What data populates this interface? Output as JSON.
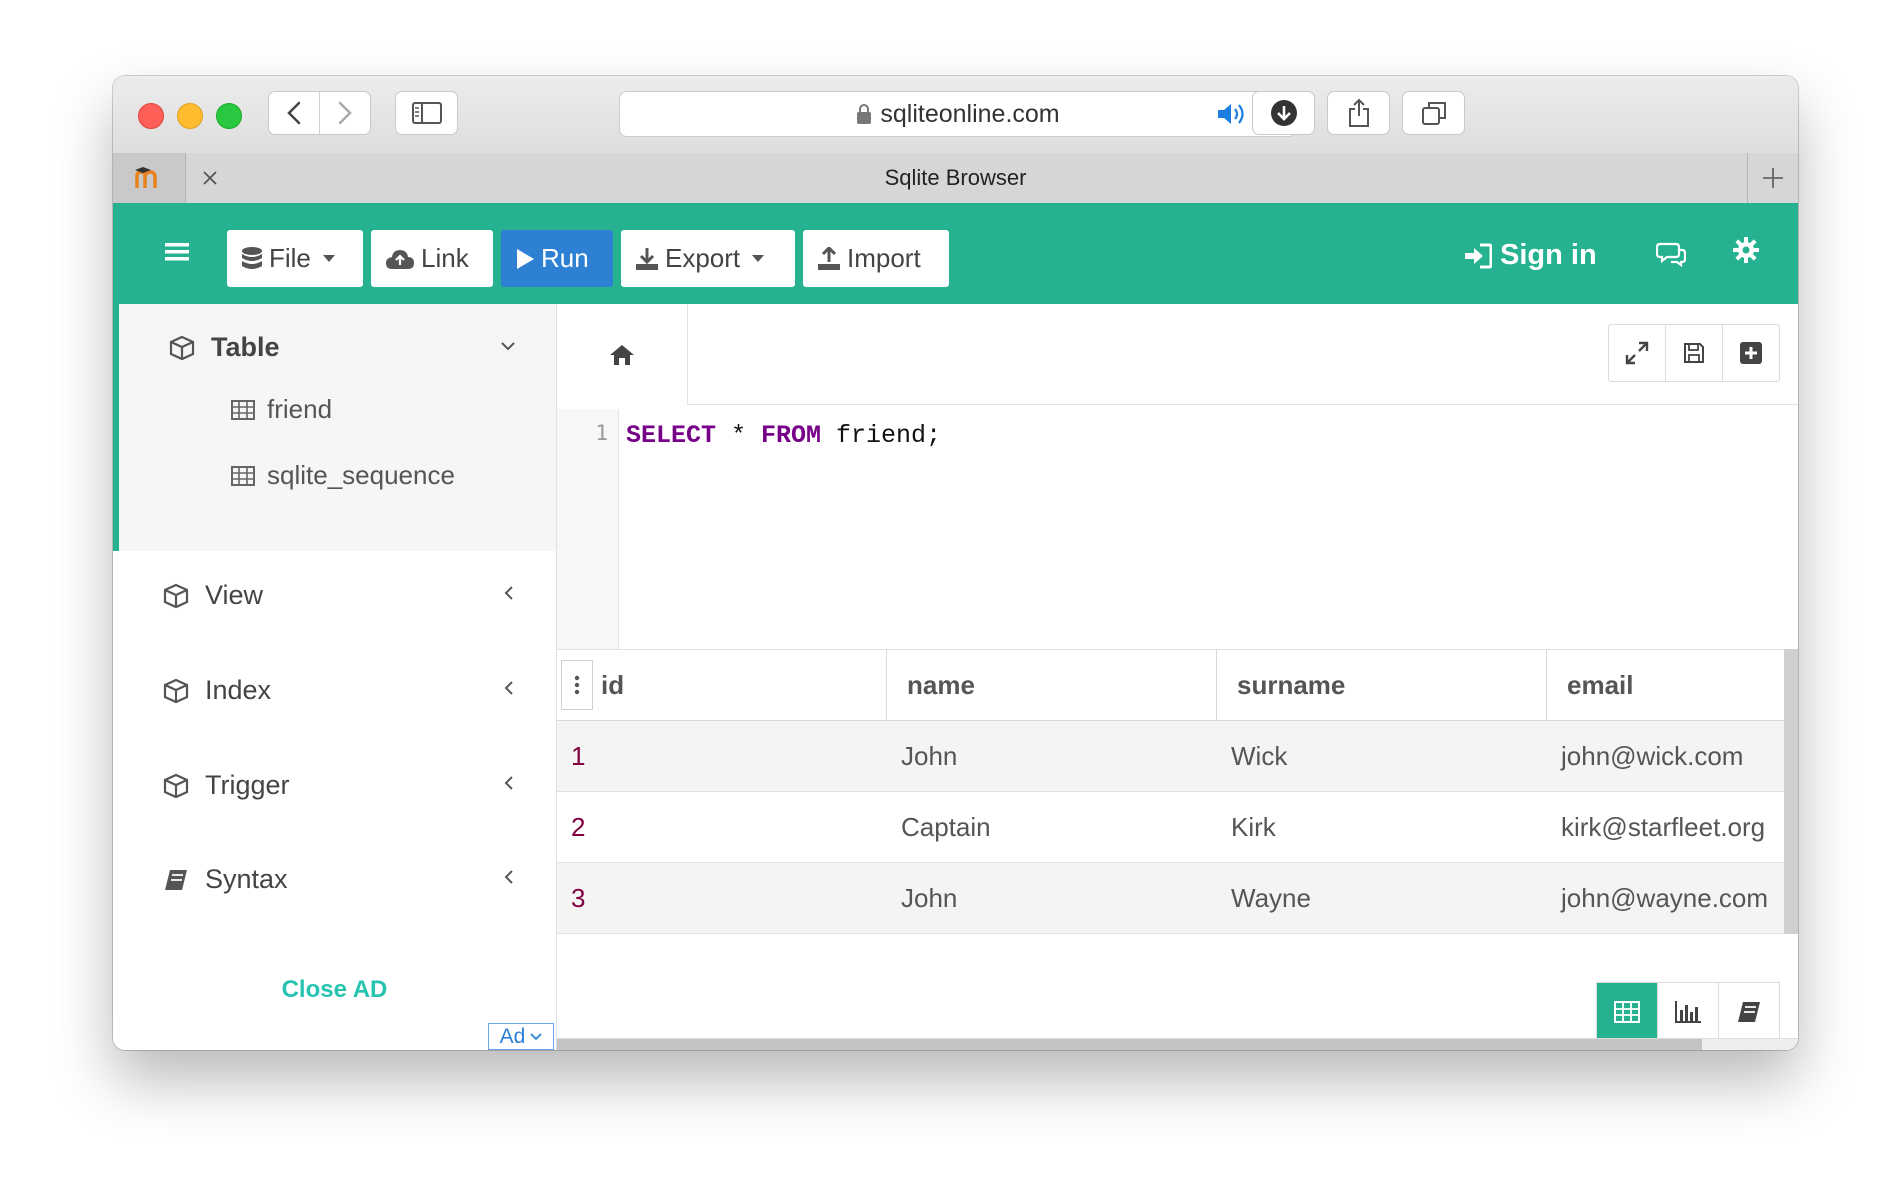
{
  "browser": {
    "url": "sqliteonline.com",
    "tab_title": "Sqlite Browser"
  },
  "toolbar": {
    "file_label": "File",
    "link_label": "Link",
    "run_label": "Run",
    "export_label": "Export",
    "import_label": "Import",
    "signin_label": "Sign in",
    "accent_color": "#26b291",
    "run_color": "#2d80d2"
  },
  "sidebar": {
    "table_label": "Table",
    "tables": [
      "friend",
      "sqlite_sequence"
    ],
    "view_label": "View",
    "index_label": "Index",
    "trigger_label": "Trigger",
    "syntax_label": "Syntax",
    "close_ad_label": "Close AD",
    "ad_label": "Ad"
  },
  "editor": {
    "line_number": "1",
    "kw1": "SELECT",
    "mid": " * ",
    "kw2": "FROM",
    "rest": " friend;"
  },
  "grid": {
    "columns": [
      "id",
      "name",
      "surname",
      "email"
    ],
    "rows": [
      [
        "1",
        "John",
        "Wick",
        "john@wick.com"
      ],
      [
        "2",
        "Captain",
        "Kirk",
        "kirk@starfleet.org"
      ],
      [
        "3",
        "John",
        "Wayne",
        "john@wayne.com"
      ]
    ]
  }
}
